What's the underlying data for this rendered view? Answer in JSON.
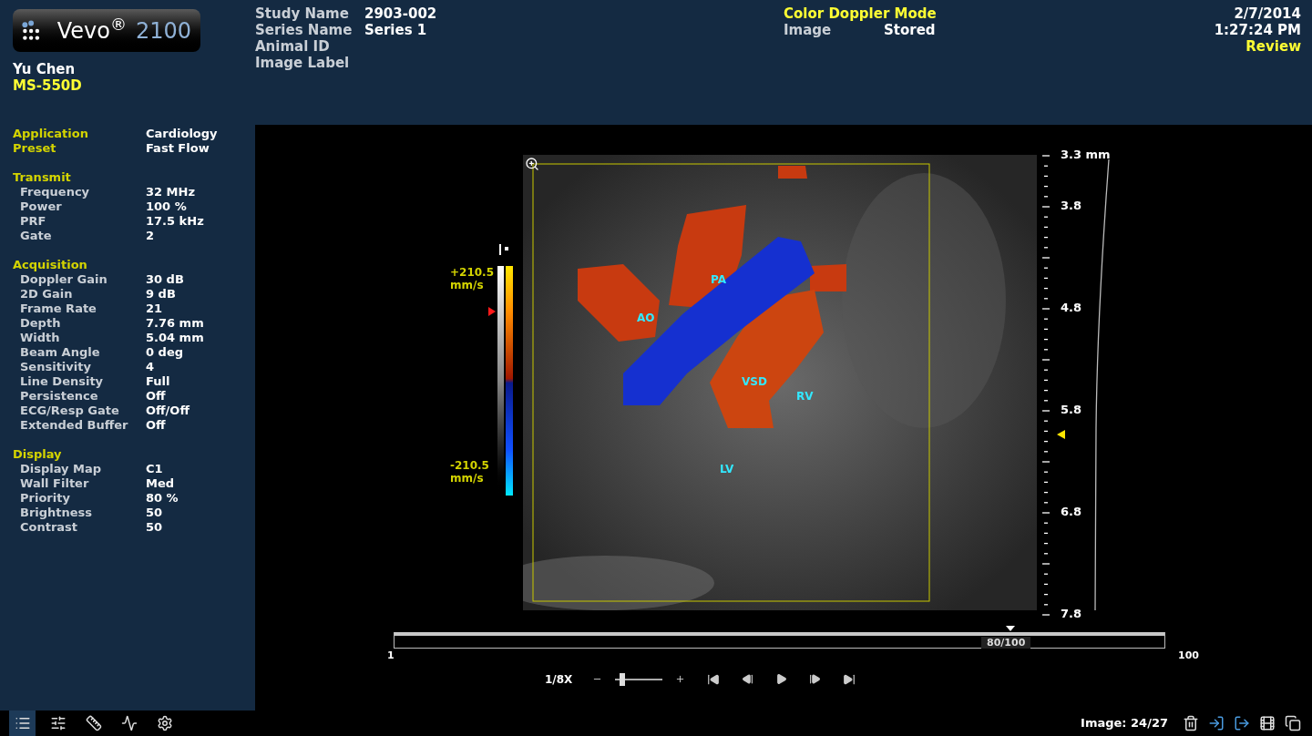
{
  "logo": {
    "name": "Vevo$^{®}$",
    "model": "2100"
  },
  "header": {
    "user": "Yu Chen",
    "probe": "MS-550D",
    "study_fields": [
      {
        "label": "Study Name",
        "value": "2903-002"
      },
      {
        "label": "Series Name",
        "value": "Series 1"
      },
      {
        "label": "Animal ID"
      },
      {
        "label": "Image Label"
      }
    ],
    "mode": "Color Doppler Mode",
    "image_field": {
      "label": "Image",
      "value": "Stored"
    },
    "date": "2/7/2014",
    "time": "1:27:24 PM",
    "status": "Review"
  },
  "sidebar": {
    "top_rows": [
      {
        "label": "Application",
        "value": "Cardiology"
      },
      {
        "label": "Preset",
        "value": "Fast Flow"
      }
    ],
    "sections": [
      {
        "title": "Transmit",
        "rows": [
          {
            "label": "Frequency",
            "value": "32 MHz"
          },
          {
            "label": "Power",
            "value": "100 %"
          },
          {
            "label": "PRF",
            "value": "17.5 kHz"
          },
          {
            "label": "Gate",
            "value": "2"
          }
        ]
      },
      {
        "title": "Acquisition",
        "rows": [
          {
            "label": "Doppler Gain",
            "value": "30 dB"
          },
          {
            "label": "2D Gain",
            "value": "9 dB"
          },
          {
            "label": "Frame Rate",
            "value": "21"
          },
          {
            "label": "Depth",
            "value": "7.76 mm"
          },
          {
            "label": "Width",
            "value": "5.04 mm"
          },
          {
            "label": "Beam Angle",
            "value": "0 deg"
          },
          {
            "label": "Sensitivity",
            "value": "4"
          },
          {
            "label": "Line Density",
            "value": "Full"
          },
          {
            "label": "Persistence",
            "value": "Off"
          },
          {
            "label": "ECG/Resp Gate",
            "value": "Off/Off"
          },
          {
            "label": "Extended Buffer",
            "value": "Off"
          }
        ]
      },
      {
        "title": "Display",
        "rows": [
          {
            "label": "Display Map",
            "value": "C1"
          },
          {
            "label": "Wall Filter",
            "value": "Med"
          },
          {
            "label": "Priority",
            "value": "80 %"
          },
          {
            "label": "Brightness",
            "value": "50"
          },
          {
            "label": "Contrast",
            "value": "50"
          }
        ]
      }
    ]
  },
  "color_bar": {
    "top": {
      "value": "+210.5",
      "unit": "mm/s"
    },
    "bottom": {
      "value": "-210.5",
      "unit": "mm/s"
    }
  },
  "image": {
    "annotations": [
      "AO",
      "PA",
      "VSD",
      "RV",
      "LV"
    ]
  },
  "depth_scale": {
    "labels": [
      "3.3 mm",
      "3.8",
      "4.8",
      "5.8",
      "6.8",
      "7.8"
    ]
  },
  "timeline": {
    "start": "1",
    "end": "100",
    "position": "80/100",
    "level": 0.8
  },
  "playback": {
    "speed": "1/8X",
    "speed_slider": {
      "level": 0.15
    }
  },
  "toolbar": [
    {
      "selected": true
    },
    {
      "selected": false
    },
    {
      "selected": false
    },
    {
      "selected": false
    },
    {
      "selected": false
    }
  ],
  "status": {
    "image_counter": "Image: 24/27"
  }
}
